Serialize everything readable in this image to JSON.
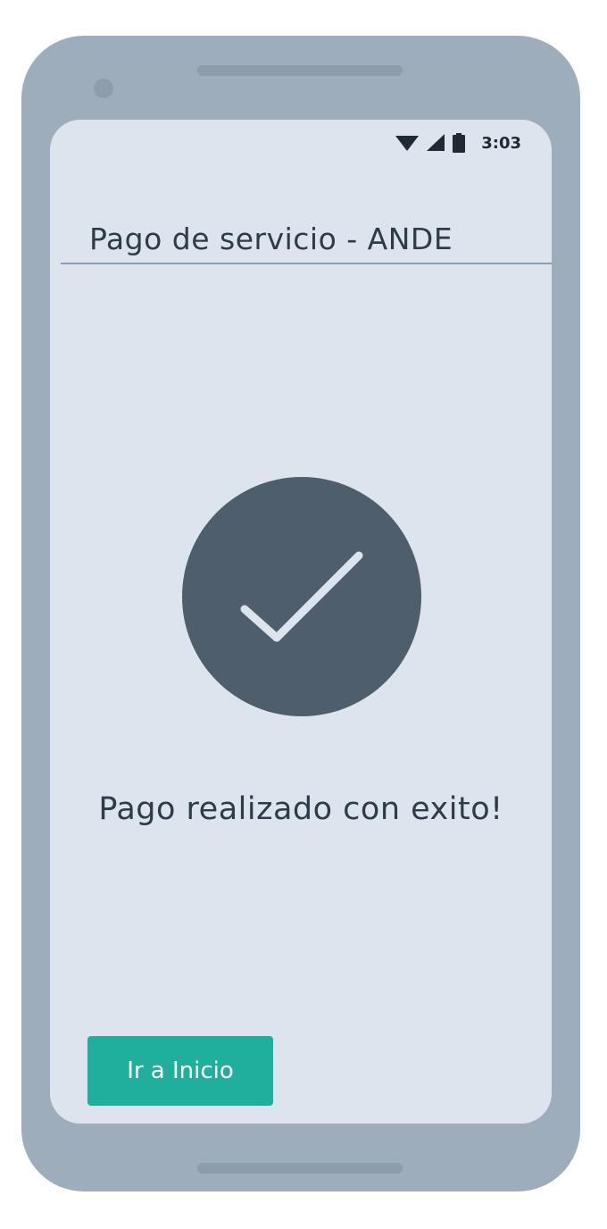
{
  "status_bar": {
    "time": "3:03",
    "icons": [
      "wifi-icon",
      "cell-signal-icon",
      "battery-icon"
    ]
  },
  "header": {
    "title": "Pago de servicio - ANDE"
  },
  "main": {
    "icon": "check-circle-icon",
    "message": "Pago realizado con exito!"
  },
  "actions": {
    "home_label": "Ir a Inicio"
  },
  "colors": {
    "frame": "#9dadbb",
    "screen": "#dde4ed",
    "circle": "#4e5e6c",
    "accent": "#1faf9c",
    "text": "#2e3c4a"
  }
}
